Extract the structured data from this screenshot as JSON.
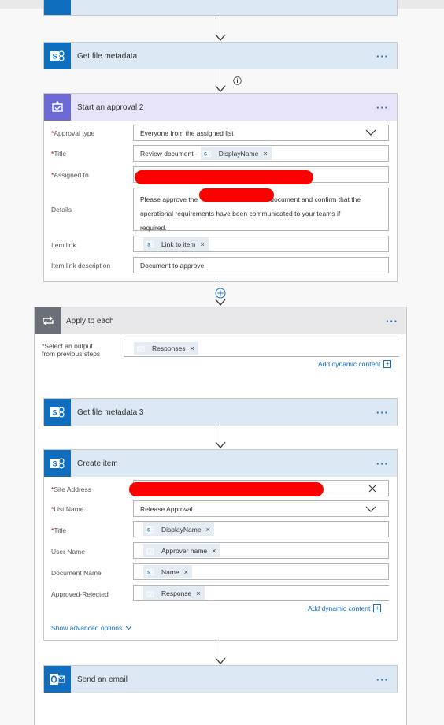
{
  "cards": {
    "get_file_metadata": {
      "title": "Get file metadata"
    },
    "start_approval": {
      "title": "Start an approval 2",
      "fields": {
        "approval_type": {
          "label": "Approval type",
          "value": "Everyone from the assigned list"
        },
        "title": {
          "label": "Title",
          "prefix": "Review document -",
          "token": "DisplayName"
        },
        "assigned_to": {
          "label": "Assigned to"
        },
        "details": {
          "label": "Details",
          "line1a": "Please approve the",
          "line1b": "document and confirm that the",
          "line2": "operational requirements have been communicated to your teams if",
          "line3": "required."
        },
        "item_link": {
          "label": "Item link",
          "token": "Link to item"
        },
        "item_link_description": {
          "label": "Item link description",
          "value": "Document to approve"
        }
      }
    },
    "apply_to_each": {
      "title": "Apply to each",
      "select_label_1": "*Select an output",
      "select_label_2": "from previous steps",
      "token": "Responses",
      "add_dynamic": "Add dynamic content"
    },
    "get_file_metadata_3": {
      "title": "Get file metadata 3"
    },
    "create_item": {
      "title": "Create item",
      "fields": {
        "site_address": {
          "label": "Site Address"
        },
        "list_name": {
          "label": "List Name",
          "value": "Release Approval"
        },
        "title": {
          "label": "Title",
          "token": "DisplayName"
        },
        "user_name": {
          "label": "User Name",
          "token": "Approver name"
        },
        "document_name": {
          "label": "Document Name",
          "token": "Name"
        },
        "approved_rejected": {
          "label": "Approved-Rejected",
          "token": "Response"
        }
      },
      "add_dynamic": "Add dynamic content",
      "show_advanced": "Show advanced options"
    },
    "send_email": {
      "title": "Send an email"
    }
  },
  "glyphs": {
    "dots": "···",
    "remove": "×",
    "required": "*"
  },
  "colors": {
    "sharepoint": "#0f6ebd",
    "approval": "#6d6ad6",
    "loop": "#6b6f78",
    "redaction": "#ff0000"
  }
}
